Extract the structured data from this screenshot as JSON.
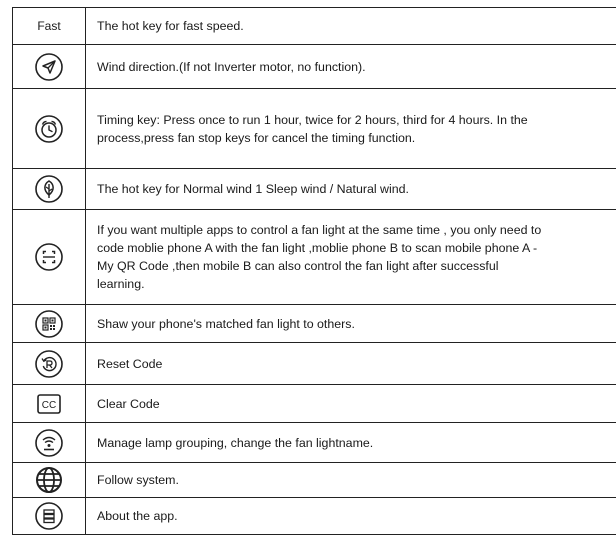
{
  "rows": [
    {
      "icon": "fast-text",
      "label": "Fast",
      "desc": [
        "The hot key for fast speed."
      ]
    },
    {
      "icon": "paper-plane-icon",
      "desc": [
        "Wind direction.(If not Inverter motor, no function)."
      ]
    },
    {
      "icon": "alarm-clock-icon",
      "desc": [
        "Timing key: Press once to run 1 hour, twice for 2 hours, third for 4 hours. In the",
        "process,press fan stop keys for cancel the timing function."
      ]
    },
    {
      "icon": "leaf-icon",
      "desc": [
        "The hot key for Normal wind 1 Sleep wind / Natural wind."
      ]
    },
    {
      "icon": "scan-icon",
      "desc": [
        "If you want multiple apps to control a fan light at the same time , you only need to",
        "code moblie phone A with the fan light ,moblie phone B to scan mobile phone A -",
        "My QR Code ,then mobile B can also control the fan light after successful",
        "learning."
      ]
    },
    {
      "icon": "qr-code-icon",
      "desc": [
        "Shaw your phone's matched fan light to others."
      ]
    },
    {
      "icon": "reset-icon",
      "desc": [
        "Reset Code"
      ]
    },
    {
      "icon": "cc-icon",
      "label": "CC",
      "desc": [
        "Clear Code"
      ]
    },
    {
      "icon": "wifi-lamp-icon",
      "desc": [
        "Manage lamp grouping, change the fan lightname."
      ]
    },
    {
      "icon": "globe-icon",
      "desc": [
        "Follow system."
      ]
    },
    {
      "icon": "menu-list-icon",
      "desc": [
        "About the app."
      ]
    }
  ]
}
